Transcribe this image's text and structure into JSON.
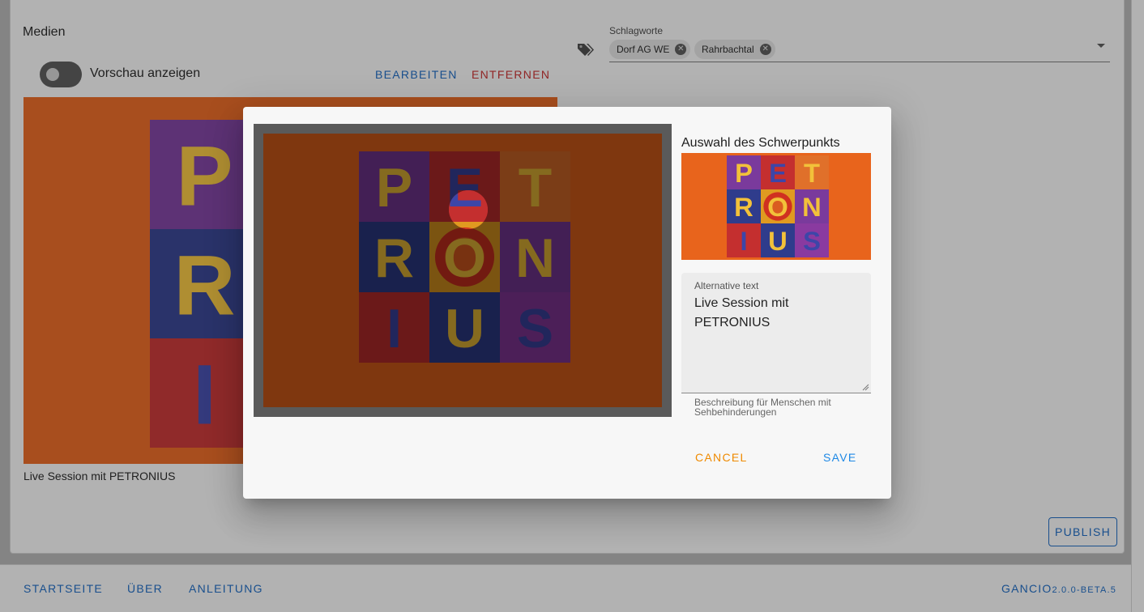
{
  "media": {
    "section_title": "Medien",
    "preview_toggle_label": "Vorschau anzeigen",
    "preview_toggle_on": false,
    "edit_label": "BEARBEITEN",
    "remove_label": "ENTFERNEN",
    "image_caption": "Live Session mit PETRONIUS"
  },
  "tags": {
    "label": "Schlagworte",
    "icon": "tags-icon",
    "chips": [
      "Dorf AG WE",
      "Rahrbachtal"
    ]
  },
  "publish_label": "PUBLISH",
  "footer": {
    "links": [
      "STARTSEITE",
      "ÜBER",
      "ANLEITUNG"
    ],
    "app_name": "GANCIO",
    "version": "2.0.0-BETA.5"
  },
  "dialog": {
    "preview_title": "Auswahl des Schwerpunkts",
    "alt_label": "Alternative text",
    "alt_value": "Live Session mit\nPETRONIUS",
    "alt_hint": "Beschreibung für Menschen mit Sehbehinderungen",
    "cancel_label": "CANCEL",
    "save_label": "SAVE"
  },
  "logo": {
    "letters": [
      "P",
      "E",
      "T",
      "R",
      "O",
      "N",
      "I",
      "U",
      "S"
    ]
  },
  "colors": {
    "accent": "#1565c0",
    "danger": "#c62828",
    "cancel": "#ef8a00",
    "save": "#1e88e5",
    "image_background": "#e8641c"
  }
}
